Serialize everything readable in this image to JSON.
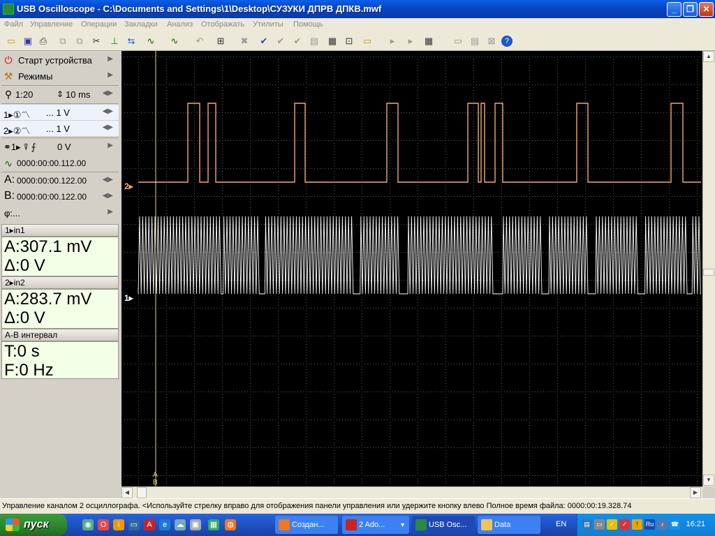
{
  "window": {
    "title": "USB Oscilloscope - C:\\Documents and Settings\\1\\Desktop\\СУЗУКИ ДПРВ ДПКВ.mwf"
  },
  "menu": [
    "Файл",
    "Управление",
    "Операции",
    "Закладки",
    "Анализ",
    "Отображать",
    "Утилиты",
    "Помощь"
  ],
  "leftpanel": {
    "start_device": "Старт устройства",
    "modes": "Режимы",
    "zoom": "1:20",
    "timebase": "10 ms",
    "ch1_volts": "... 1 V",
    "ch2_volts": "... 1 V",
    "trigger_level": "0 V",
    "trigger_time": "0000:00:00.112.00",
    "cursor_a_label": "A:",
    "cursor_a": "0000:00:00.122.00",
    "cursor_b_label": "B:",
    "cursor_b": "0000:00:00.122.00",
    "phase": "φ:...",
    "ch1_header": "in1",
    "ch1_value": "A:307.1 mV",
    "ch1_delta": "Δ:0 V",
    "ch2_header": "in2",
    "ch2_value": "A:283.7 mV",
    "ch2_delta": "Δ:0 V",
    "ab_header": "A-B интервал",
    "ab_time": "T:0 s",
    "ab_freq": "F:0 Hz"
  },
  "scope": {
    "ch1_marker": "1",
    "ch2_marker": "2",
    "cursor_a": "A",
    "cursor_b": "B",
    "ch1_color": "#ffffff",
    "ch2_color": "#f5a970",
    "grid_color": "#4a6a4a"
  },
  "status": {
    "text": "Управление каналом 2 осциллографа. <Используйте стрелку вправо для отображения панели управления или удержите кнопку влево  Полное время файла: 0000:00:19.328.74"
  },
  "taskbar": {
    "start": "пуск",
    "tasks": [
      "Создан...",
      "2 Ado...",
      "USB Osc...",
      "Data"
    ],
    "lang": "EN",
    "tray_ru": "Ru",
    "clock": "16:21"
  }
}
